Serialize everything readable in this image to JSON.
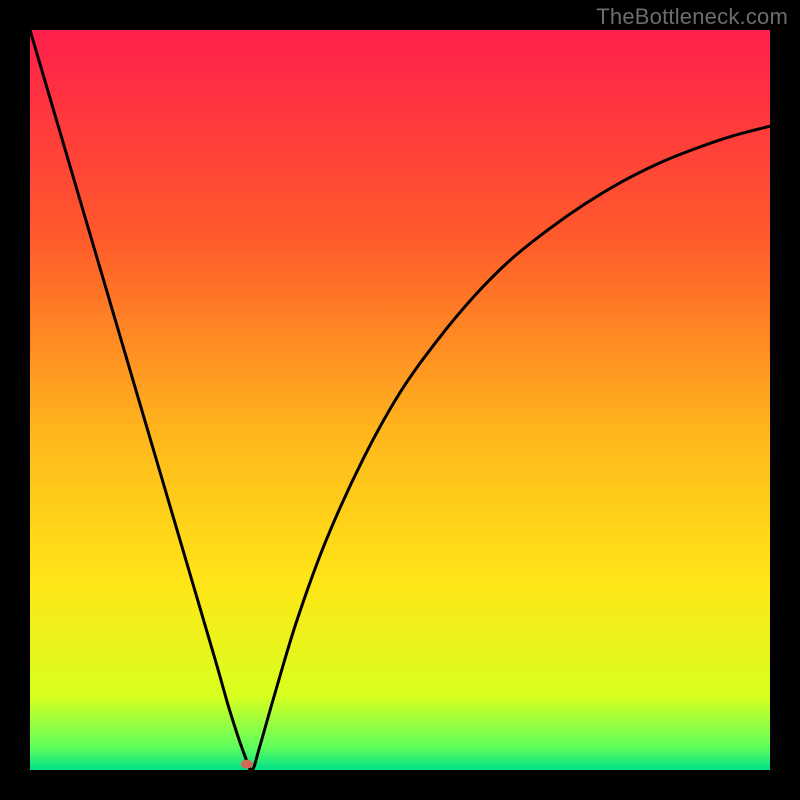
{
  "watermark": "TheBottleneck.com",
  "chart_data": {
    "type": "line",
    "title": "",
    "xlabel": "",
    "ylabel": "",
    "xlim": [
      0,
      100
    ],
    "ylim": [
      0,
      100
    ],
    "y_axis_meaning": "bottleneck percentage (0 = balanced, 100 = fully bottlenecked)",
    "background_gradient_stops": [
      {
        "pct": 0,
        "color": "#ff1f4b"
      },
      {
        "pct": 28,
        "color": "#ff5a2b"
      },
      {
        "pct": 55,
        "color": "#ffb81c"
      },
      {
        "pct": 75,
        "color": "#ffe617"
      },
      {
        "pct": 90,
        "color": "#d8ff1e"
      },
      {
        "pct": 97,
        "color": "#5dff5d"
      },
      {
        "pct": 100,
        "color": "#00e08a"
      }
    ],
    "series": [
      {
        "name": "bottleneck-curve",
        "x": [
          0,
          5,
          10,
          15,
          20,
          25,
          27,
          29,
          30,
          31,
          33,
          36,
          40,
          45,
          50,
          55,
          60,
          65,
          70,
          75,
          80,
          85,
          90,
          95,
          100
        ],
        "y": [
          100,
          83,
          66,
          49,
          32,
          15,
          8,
          2,
          0,
          3,
          10,
          20,
          31,
          42,
          51,
          58,
          64,
          69,
          73,
          76.5,
          79.5,
          82,
          84,
          85.7,
          87
        ]
      }
    ],
    "marker": {
      "x": 29.3,
      "y": 0.8,
      "color": "#d46a55",
      "rx": 6,
      "ry": 4.5
    }
  }
}
